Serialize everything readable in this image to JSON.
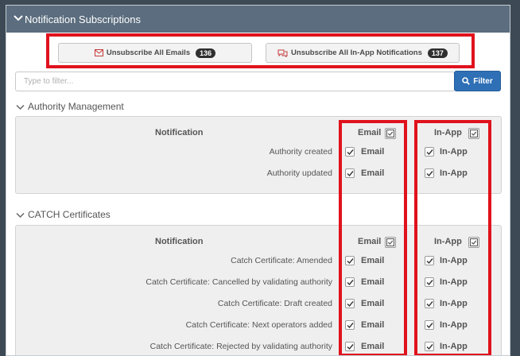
{
  "panel": {
    "title": "Notification Subscriptions"
  },
  "actions": {
    "unsubscribe_emails_label": "Unsubscribe All Emails",
    "unsubscribe_emails_count": "136",
    "unsubscribe_inapp_label": "Unsubscribe All In-App Notifications",
    "unsubscribe_inapp_count": "137"
  },
  "filter": {
    "placeholder": "Type to filter...",
    "value": "",
    "button_label": "Filter"
  },
  "columns": {
    "notification": "Notification",
    "email": "Email",
    "inapp": "In-App"
  },
  "option_labels": {
    "email": "Email",
    "inapp": "In-App"
  },
  "sections": [
    {
      "title": "Authority Management",
      "rows": [
        {
          "label": "Authority created",
          "email": true,
          "inapp": true
        },
        {
          "label": "Authority updated",
          "email": true,
          "inapp": true
        }
      ]
    },
    {
      "title": "CATCH Certificates",
      "rows": [
        {
          "label": "Catch Certificate: Amended",
          "email": true,
          "inapp": true
        },
        {
          "label": "Catch Certificate: Cancelled by validating authority",
          "email": true,
          "inapp": true
        },
        {
          "label": "Catch Certificate: Draft created",
          "email": true,
          "inapp": true
        },
        {
          "label": "Catch Certificate: Next operators added",
          "email": true,
          "inapp": true
        },
        {
          "label": "Catch Certificate: Rejected by validating authority",
          "email": true,
          "inapp": true
        }
      ]
    }
  ],
  "colors": {
    "header_bg": "#5b6d7e",
    "primary_button": "#2e6fb5",
    "highlight_outline": "#e0121c",
    "badge_bg": "#2f2f2f"
  },
  "icons": {
    "collapse": "chevron-down-icon",
    "unsubscribe_emails": "envelope-icon",
    "unsubscribe_inapp": "comments-icon",
    "filter": "search-icon",
    "toggle_all": "check-square-icon"
  }
}
